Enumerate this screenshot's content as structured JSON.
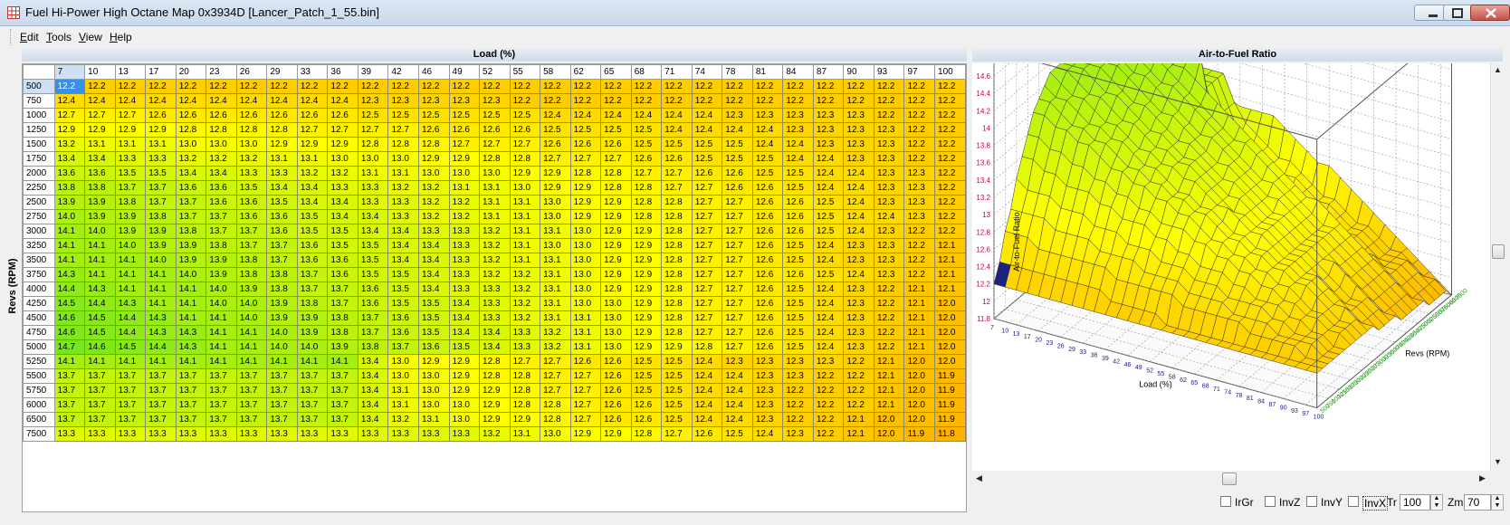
{
  "window": {
    "title": "Fuel Hi-Power High Octane Map 0x3934D [Lancer_Patch_1_55.bin]"
  },
  "menu": {
    "items": [
      {
        "label": "Edit",
        "u": "E",
        "rest": "dit"
      },
      {
        "label": "Tools",
        "u": "T",
        "rest": "ools"
      },
      {
        "label": "View",
        "u": "V",
        "rest": "iew"
      },
      {
        "label": "Help",
        "u": "H",
        "rest": "elp"
      }
    ]
  },
  "table": {
    "x_axis_title": "Load (%)",
    "y_axis_title": "Revs (RPM)",
    "load_cols": [
      "7",
      "10",
      "13",
      "17",
      "20",
      "23",
      "26",
      "29",
      "33",
      "36",
      "39",
      "42",
      "46",
      "49",
      "52",
      "55",
      "58",
      "62",
      "65",
      "68",
      "71",
      "74",
      "78",
      "81",
      "84",
      "87",
      "90",
      "93",
      "97",
      "100"
    ],
    "rpm_rows": [
      "500",
      "750",
      "1000",
      "1250",
      "1500",
      "1750",
      "2000",
      "2250",
      "2500",
      "2750",
      "3000",
      "3250",
      "3500",
      "3750",
      "4000",
      "4250",
      "4500",
      "4750",
      "5000",
      "5250",
      "5500",
      "5750",
      "6000",
      "6500",
      "7500"
    ],
    "selected_cell": {
      "row": 0,
      "col": 0
    },
    "values": [
      [
        "12.2",
        "12.2",
        "12.2",
        "12.2",
        "12.2",
        "12.2",
        "12.2",
        "12.2",
        "12.2",
        "12.2",
        "12.2",
        "12.2",
        "12.2",
        "12.2",
        "12.2",
        "12.2",
        "12.2",
        "12.2",
        "12.2",
        "12.2",
        "12.2",
        "12.2",
        "12.2",
        "12.2",
        "12.2",
        "12.2",
        "12.2",
        "12.2",
        "12.2",
        "12.2"
      ],
      [
        "12.4",
        "12.4",
        "12.4",
        "12.4",
        "12.4",
        "12.4",
        "12.4",
        "12.4",
        "12.4",
        "12.4",
        "12.3",
        "12.3",
        "12.3",
        "12.3",
        "12.3",
        "12.2",
        "12.2",
        "12.2",
        "12.2",
        "12.2",
        "12.2",
        "12.2",
        "12.2",
        "12.2",
        "12.2",
        "12.2",
        "12.2",
        "12.2",
        "12.2",
        "12.2"
      ],
      [
        "12.7",
        "12.7",
        "12.7",
        "12.6",
        "12.6",
        "12.6",
        "12.6",
        "12.6",
        "12.6",
        "12.6",
        "12.5",
        "12.5",
        "12.5",
        "12.5",
        "12.5",
        "12.5",
        "12.4",
        "12.4",
        "12.4",
        "12.4",
        "12.4",
        "12.4",
        "12.3",
        "12.3",
        "12.3",
        "12.3",
        "12.3",
        "12.2",
        "12.2",
        "12.2"
      ],
      [
        "12.9",
        "12.9",
        "12.9",
        "12.9",
        "12.8",
        "12.8",
        "12.8",
        "12.8",
        "12.7",
        "12.7",
        "12.7",
        "12.7",
        "12.6",
        "12.6",
        "12.6",
        "12.6",
        "12.5",
        "12.5",
        "12.5",
        "12.5",
        "12.4",
        "12.4",
        "12.4",
        "12.4",
        "12.3",
        "12.3",
        "12.3",
        "12.3",
        "12.2",
        "12.2"
      ],
      [
        "13.2",
        "13.1",
        "13.1",
        "13.1",
        "13.0",
        "13.0",
        "13.0",
        "12.9",
        "12.9",
        "12.9",
        "12.8",
        "12.8",
        "12.8",
        "12.7",
        "12.7",
        "12.7",
        "12.6",
        "12.6",
        "12.6",
        "12.5",
        "12.5",
        "12.5",
        "12.5",
        "12.4",
        "12.4",
        "12.3",
        "12.3",
        "12.3",
        "12.2",
        "12.2"
      ],
      [
        "13.4",
        "13.4",
        "13.3",
        "13.3",
        "13.2",
        "13.2",
        "13.2",
        "13.1",
        "13.1",
        "13.0",
        "13.0",
        "13.0",
        "12.9",
        "12.9",
        "12.8",
        "12.8",
        "12.7",
        "12.7",
        "12.7",
        "12.6",
        "12.6",
        "12.5",
        "12.5",
        "12.5",
        "12.4",
        "12.4",
        "12.3",
        "12.3",
        "12.2",
        "12.2"
      ],
      [
        "13.6",
        "13.6",
        "13.5",
        "13.5",
        "13.4",
        "13.4",
        "13.3",
        "13.3",
        "13.2",
        "13.2",
        "13.1",
        "13.1",
        "13.0",
        "13.0",
        "13.0",
        "12.9",
        "12.9",
        "12.8",
        "12.8",
        "12.7",
        "12.7",
        "12.6",
        "12.6",
        "12.5",
        "12.5",
        "12.4",
        "12.4",
        "12.3",
        "12.3",
        "12.2"
      ],
      [
        "13.8",
        "13.8",
        "13.7",
        "13.7",
        "13.6",
        "13.6",
        "13.5",
        "13.4",
        "13.4",
        "13.3",
        "13.3",
        "13.2",
        "13.2",
        "13.1",
        "13.1",
        "13.0",
        "12.9",
        "12.9",
        "12.8",
        "12.8",
        "12.7",
        "12.7",
        "12.6",
        "12.6",
        "12.5",
        "12.4",
        "12.4",
        "12.3",
        "12.3",
        "12.2"
      ],
      [
        "13.9",
        "13.9",
        "13.8",
        "13.7",
        "13.7",
        "13.6",
        "13.6",
        "13.5",
        "13.4",
        "13.4",
        "13.3",
        "13.3",
        "13.2",
        "13.2",
        "13.1",
        "13.1",
        "13.0",
        "12.9",
        "12.9",
        "12.8",
        "12.8",
        "12.7",
        "12.7",
        "12.6",
        "12.6",
        "12.5",
        "12.4",
        "12.3",
        "12.3",
        "12.2"
      ],
      [
        "14.0",
        "13.9",
        "13.9",
        "13.8",
        "13.7",
        "13.7",
        "13.6",
        "13.6",
        "13.5",
        "13.4",
        "13.4",
        "13.3",
        "13.2",
        "13.2",
        "13.1",
        "13.1",
        "13.0",
        "12.9",
        "12.9",
        "12.8",
        "12.8",
        "12.7",
        "12.7",
        "12.6",
        "12.6",
        "12.5",
        "12.4",
        "12.4",
        "12.3",
        "12.2"
      ],
      [
        "14.1",
        "14.0",
        "13.9",
        "13.9",
        "13.8",
        "13.7",
        "13.7",
        "13.6",
        "13.5",
        "13.5",
        "13.4",
        "13.4",
        "13.3",
        "13.3",
        "13.2",
        "13.1",
        "13.1",
        "13.0",
        "12.9",
        "12.9",
        "12.8",
        "12.7",
        "12.7",
        "12.6",
        "12.6",
        "12.5",
        "12.4",
        "12.3",
        "12.2",
        "12.2"
      ],
      [
        "14.1",
        "14.1",
        "14.0",
        "13.9",
        "13.9",
        "13.8",
        "13.7",
        "13.7",
        "13.6",
        "13.5",
        "13.5",
        "13.4",
        "13.4",
        "13.3",
        "13.2",
        "13.1",
        "13.0",
        "13.0",
        "12.9",
        "12.9",
        "12.8",
        "12.7",
        "12.7",
        "12.6",
        "12.5",
        "12.4",
        "12.3",
        "12.3",
        "12.2",
        "12.1"
      ],
      [
        "14.1",
        "14.1",
        "14.1",
        "14.0",
        "13.9",
        "13.9",
        "13.8",
        "13.7",
        "13.6",
        "13.6",
        "13.5",
        "13.4",
        "13.4",
        "13.3",
        "13.2",
        "13.1",
        "13.1",
        "13.0",
        "12.9",
        "12.9",
        "12.8",
        "12.7",
        "12.7",
        "12.6",
        "12.5",
        "12.4",
        "12.3",
        "12.3",
        "12.2",
        "12.1"
      ],
      [
        "14.3",
        "14.1",
        "14.1",
        "14.1",
        "14.0",
        "13.9",
        "13.8",
        "13.8",
        "13.7",
        "13.6",
        "13.5",
        "13.5",
        "13.4",
        "13.3",
        "13.2",
        "13.2",
        "13.1",
        "13.0",
        "12.9",
        "12.9",
        "12.8",
        "12.7",
        "12.7",
        "12.6",
        "12.6",
        "12.5",
        "12.4",
        "12.3",
        "12.2",
        "12.1"
      ],
      [
        "14.4",
        "14.3",
        "14.1",
        "14.1",
        "14.1",
        "14.0",
        "13.9",
        "13.8",
        "13.7",
        "13.7",
        "13.6",
        "13.5",
        "13.4",
        "13.3",
        "13.3",
        "13.2",
        "13.1",
        "13.0",
        "12.9",
        "12.9",
        "12.8",
        "12.7",
        "12.7",
        "12.6",
        "12.5",
        "12.4",
        "12.3",
        "12.2",
        "12.1",
        "12.1"
      ],
      [
        "14.5",
        "14.4",
        "14.3",
        "14.1",
        "14.1",
        "14.0",
        "14.0",
        "13.9",
        "13.8",
        "13.7",
        "13.6",
        "13.5",
        "13.5",
        "13.4",
        "13.3",
        "13.2",
        "13.1",
        "13.0",
        "13.0",
        "12.9",
        "12.8",
        "12.7",
        "12.7",
        "12.6",
        "12.5",
        "12.4",
        "12.3",
        "12.2",
        "12.1",
        "12.0"
      ],
      [
        "14.6",
        "14.5",
        "14.4",
        "14.3",
        "14.1",
        "14.1",
        "14.0",
        "13.9",
        "13.9",
        "13.8",
        "13.7",
        "13.6",
        "13.5",
        "13.4",
        "13.3",
        "13.2",
        "13.1",
        "13.1",
        "13.0",
        "12.9",
        "12.8",
        "12.7",
        "12.7",
        "12.6",
        "12.5",
        "12.4",
        "12.3",
        "12.2",
        "12.1",
        "12.0"
      ],
      [
        "14.6",
        "14.5",
        "14.4",
        "14.3",
        "14.3",
        "14.1",
        "14.1",
        "14.0",
        "13.9",
        "13.8",
        "13.7",
        "13.6",
        "13.5",
        "13.4",
        "13.4",
        "13.3",
        "13.2",
        "13.1",
        "13.0",
        "12.9",
        "12.8",
        "12.7",
        "12.7",
        "12.6",
        "12.5",
        "12.4",
        "12.3",
        "12.2",
        "12.1",
        "12.0"
      ],
      [
        "14.7",
        "14.6",
        "14.5",
        "14.4",
        "14.3",
        "14.1",
        "14.1",
        "14.0",
        "14.0",
        "13.9",
        "13.8",
        "13.7",
        "13.6",
        "13.5",
        "13.4",
        "13.3",
        "13.2",
        "13.1",
        "13.0",
        "12.9",
        "12.9",
        "12.8",
        "12.7",
        "12.6",
        "12.5",
        "12.4",
        "12.3",
        "12.2",
        "12.1",
        "12.0"
      ],
      [
        "14.1",
        "14.1",
        "14.1",
        "14.1",
        "14.1",
        "14.1",
        "14.1",
        "14.1",
        "14.1",
        "14.1",
        "13.4",
        "13.0",
        "12.9",
        "12.9",
        "12.8",
        "12.7",
        "12.7",
        "12.6",
        "12.6",
        "12.5",
        "12.5",
        "12.4",
        "12.3",
        "12.3",
        "12.3",
        "12.3",
        "12.2",
        "12.1",
        "12.0",
        "12.0"
      ],
      [
        "13.7",
        "13.7",
        "13.7",
        "13.7",
        "13.7",
        "13.7",
        "13.7",
        "13.7",
        "13.7",
        "13.7",
        "13.4",
        "13.0",
        "13.0",
        "12.9",
        "12.8",
        "12.8",
        "12.7",
        "12.7",
        "12.6",
        "12.5",
        "12.5",
        "12.4",
        "12.4",
        "12.3",
        "12.3",
        "12.2",
        "12.2",
        "12.1",
        "12.0",
        "11.9"
      ],
      [
        "13.7",
        "13.7",
        "13.7",
        "13.7",
        "13.7",
        "13.7",
        "13.7",
        "13.7",
        "13.7",
        "13.7",
        "13.4",
        "13.1",
        "13.0",
        "12.9",
        "12.9",
        "12.8",
        "12.7",
        "12.7",
        "12.6",
        "12.5",
        "12.5",
        "12.4",
        "12.4",
        "12.3",
        "12.2",
        "12.2",
        "12.2",
        "12.1",
        "12.0",
        "11.9"
      ],
      [
        "13.7",
        "13.7",
        "13.7",
        "13.7",
        "13.7",
        "13.7",
        "13.7",
        "13.7",
        "13.7",
        "13.7",
        "13.4",
        "13.1",
        "13.0",
        "13.0",
        "12.9",
        "12.8",
        "12.8",
        "12.7",
        "12.6",
        "12.6",
        "12.5",
        "12.4",
        "12.4",
        "12.3",
        "12.2",
        "12.2",
        "12.2",
        "12.1",
        "12.0",
        "11.9"
      ],
      [
        "13.7",
        "13.7",
        "13.7",
        "13.7",
        "13.7",
        "13.7",
        "13.7",
        "13.7",
        "13.7",
        "13.7",
        "13.4",
        "13.2",
        "13.1",
        "13.0",
        "12.9",
        "12.9",
        "12.8",
        "12.7",
        "12.6",
        "12.6",
        "12.5",
        "12.4",
        "12.4",
        "12.3",
        "12.2",
        "12.2",
        "12.1",
        "12.0",
        "12.0",
        "11.9"
      ],
      [
        "13.3",
        "13.3",
        "13.3",
        "13.3",
        "13.3",
        "13.3",
        "13.3",
        "13.3",
        "13.3",
        "13.3",
        "13.3",
        "13.3",
        "13.3",
        "13.3",
        "13.2",
        "13.1",
        "13.0",
        "12.9",
        "12.9",
        "12.8",
        "12.7",
        "12.6",
        "12.5",
        "12.4",
        "12.3",
        "12.2",
        "12.1",
        "12.0",
        "11.9",
        "11.8"
      ]
    ]
  },
  "graph": {
    "title": "Air-to-Fuel Ratio",
    "z_axis_label": "Air-to-Fuel Ratio",
    "x_axis_label": "Load (%)",
    "y_axis_label": "Revs (RPM)",
    "z_ticks": [
      "14.6",
      "14.4",
      "14.2",
      "14",
      "13.8",
      "13.6",
      "13.4",
      "13.2",
      "13",
      "12.8",
      "12.6",
      "12.4",
      "12.2",
      "12",
      "11.8"
    ],
    "x_ticks": [
      "7",
      "10",
      "13",
      "17",
      "20",
      "23",
      "26",
      "29",
      "33",
      "36",
      "39",
      "42",
      "46",
      "49",
      "52",
      "55",
      "58",
      "62",
      "65",
      "68",
      "71",
      "74",
      "78",
      "81",
      "84",
      "87",
      "90",
      "93",
      "97",
      "100"
    ],
    "y_ticks": [
      "500",
      "750",
      "1000",
      "1250",
      "1500",
      "1750",
      "2000",
      "2250",
      "2500",
      "2750",
      "3000",
      "3250",
      "3500",
      "3750",
      "4000",
      "4250",
      "4500",
      "4750",
      "5000",
      "5250",
      "5500",
      "5750",
      "6000",
      "6500",
      "7500"
    ],
    "colors": {
      "high": "#7fe01a",
      "low": "#ffd21a",
      "mid": "#f5ee10"
    }
  },
  "controls": {
    "checkboxes": [
      {
        "label": "IrGr"
      },
      {
        "label": "InvZ"
      },
      {
        "label": "InvY"
      },
      {
        "label": "InvX"
      }
    ],
    "tr_label": "Tr",
    "tr_value": "100",
    "zm_label": "Zm",
    "zm_value": "70"
  }
}
